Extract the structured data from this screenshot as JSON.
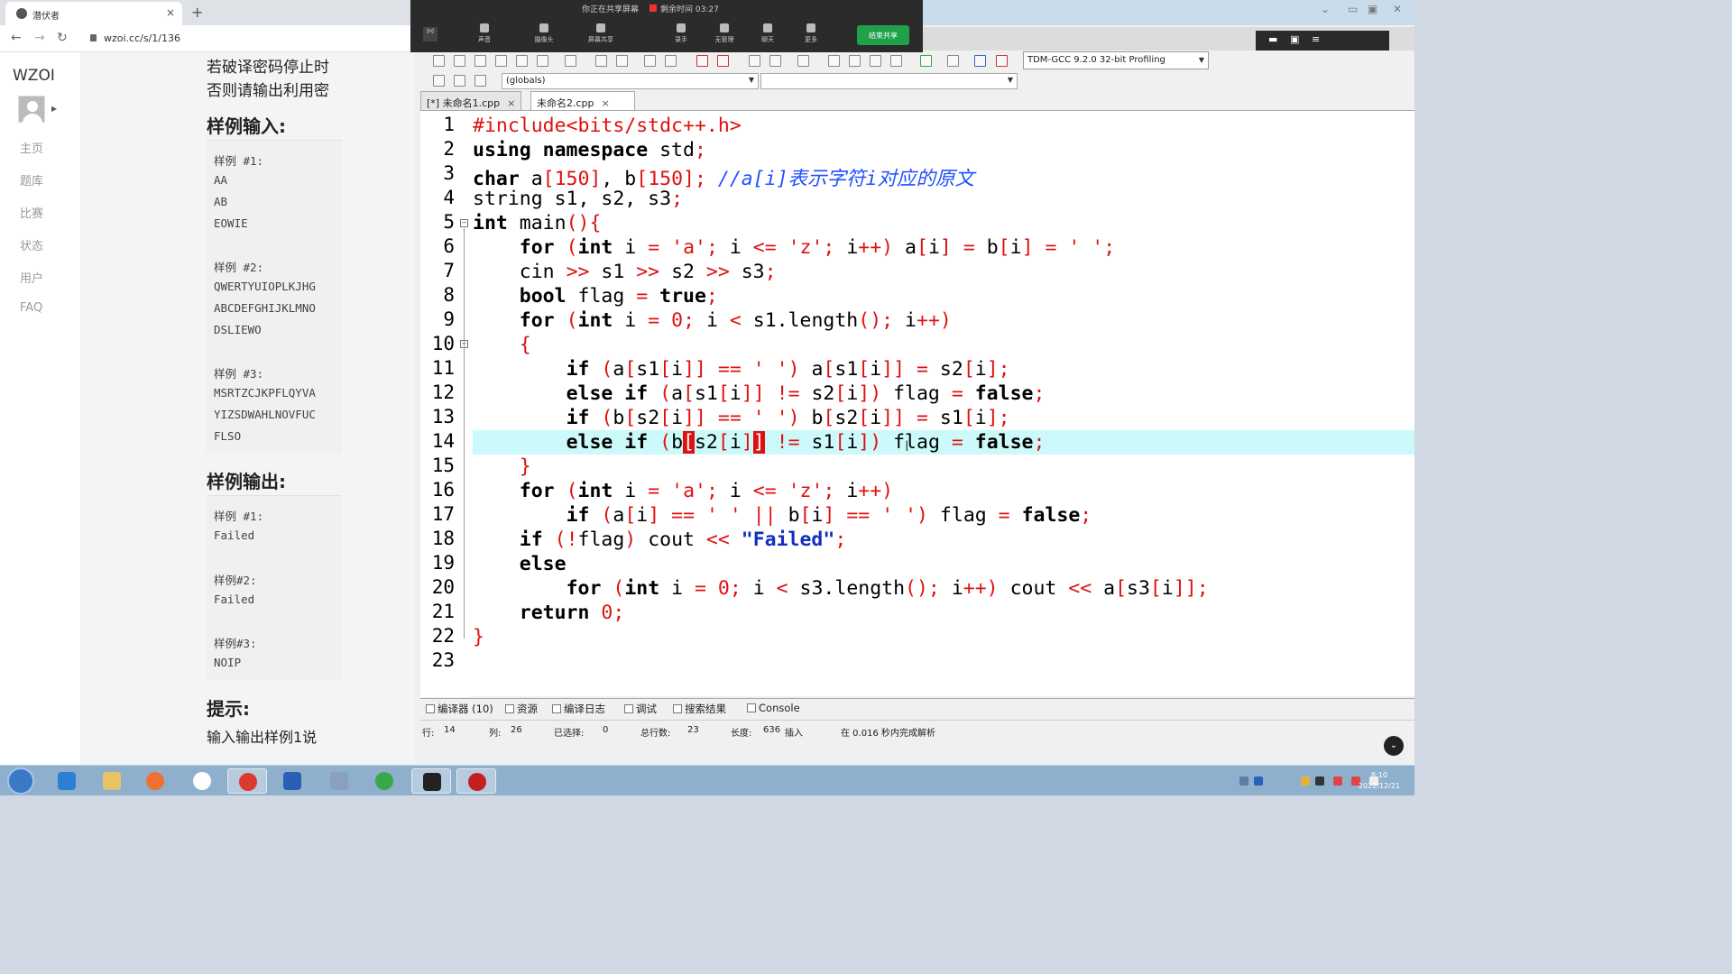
{
  "browser": {
    "tab_title": "潜伏者",
    "tab_close": "×",
    "new_tab": "+",
    "url": "wzoi.cc/s/1/136",
    "sidebar": {
      "logo": "WZOI",
      "items": [
        "主页",
        "题库",
        "比赛",
        "状态",
        "用户",
        "FAQ"
      ]
    },
    "problem": {
      "line1": "若破译密码停止时",
      "line2": "否则请输出利用密",
      "sample_input_heading": "样例输入:",
      "sample_inputs": [
        {
          "label": "样例 #1:",
          "lines": [
            "AA",
            "AB",
            "EOWIE"
          ]
        },
        {
          "label": "样例 #2:",
          "lines": [
            "QWERTYUIOPLKJHG",
            "ABCDEFGHIJKLMNO",
            "DSLIEWO"
          ]
        },
        {
          "label": "样例 #3:",
          "lines": [
            "MSRTZCJKPFLQYVA",
            "YIZSDWAHLNOVFUC",
            "FLSO"
          ]
        }
      ],
      "sample_output_heading": "样例输出:",
      "sample_outputs": [
        {
          "label": "样例 #1:",
          "lines": [
            "Failed"
          ]
        },
        {
          "label": "样例#2:",
          "lines": [
            "Failed"
          ]
        },
        {
          "label": "样例#3:",
          "lines": [
            "NOIP"
          ]
        }
      ],
      "hint_heading": "提示:",
      "hint_text": "输入输出样例1说"
    }
  },
  "meeting": {
    "status": "你正在共享屏幕",
    "timer": "剩余时间 03:27",
    "buttons": [
      "声音",
      "摄像头",
      "屏幕共享",
      "录手",
      "无管理",
      "聊天",
      "更多"
    ],
    "end_share": "结束共享"
  },
  "ide": {
    "compiler": "TDM-GCC 9.2.0 32-bit Profiling",
    "scope": "(globals)",
    "tabs": [
      {
        "label": "[*] 未命名1.cpp",
        "close": "×"
      },
      {
        "label": "未命名2.cpp",
        "close": "×"
      }
    ],
    "line_numbers": [
      "1",
      "2",
      "3",
      "4",
      "5",
      "6",
      "7",
      "8",
      "9",
      "10",
      "11",
      "12",
      "13",
      "14",
      "15",
      "16",
      "17",
      "18",
      "19",
      "20",
      "21",
      "22",
      "23"
    ],
    "current_line": 14,
    "bottom_tabs": [
      "编译器 (10)",
      "资源",
      "编译日志",
      "调试",
      "搜索结果",
      "Console"
    ],
    "status": {
      "row_label": "行:",
      "row": "14",
      "col_label": "列:",
      "col": "26",
      "sel_label": "已选择:",
      "sel": "0",
      "total_label": "总行数:",
      "total": "23",
      "len_label": "长度:",
      "len": "636",
      "mode": "插入",
      "parse": "在 0.016 秒内完成解析"
    }
  },
  "taskbar": {
    "clock_time": "8:10",
    "clock_date": "2022/12/21"
  },
  "colors": {
    "keyword": "#000000",
    "symbol": "#e01010",
    "string": "#1030c0",
    "comment": "#2050ff",
    "current_line": "#ccfafa",
    "end_share": "#1fa14a"
  }
}
